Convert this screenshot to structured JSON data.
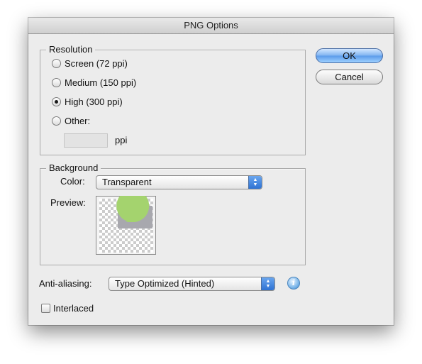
{
  "dialog": {
    "title": "PNG Options"
  },
  "resolution": {
    "legend": "Resolution",
    "options": [
      {
        "label": "Screen (72 ppi)",
        "selected": false
      },
      {
        "label": "Medium (150 ppi)",
        "selected": false
      },
      {
        "label": "High (300 ppi)",
        "selected": true
      },
      {
        "label": "Other:",
        "selected": false
      }
    ],
    "other_value": "",
    "unit_label": "ppi"
  },
  "background": {
    "legend": "Background",
    "color_label": "Color:",
    "color_value": "Transparent",
    "preview_label": "Preview:"
  },
  "antialiasing": {
    "label": "Anti-aliasing:",
    "value": "Type Optimized (Hinted)"
  },
  "interlaced": {
    "label": "Interlaced",
    "checked": false
  },
  "buttons": {
    "ok": "OK",
    "cancel": "Cancel"
  },
  "icons": {
    "info": "i"
  },
  "colors": {
    "accent": "#4f93e6",
    "preview_shape": "#a4d36e",
    "preview_gray": "#a8a8ae"
  }
}
